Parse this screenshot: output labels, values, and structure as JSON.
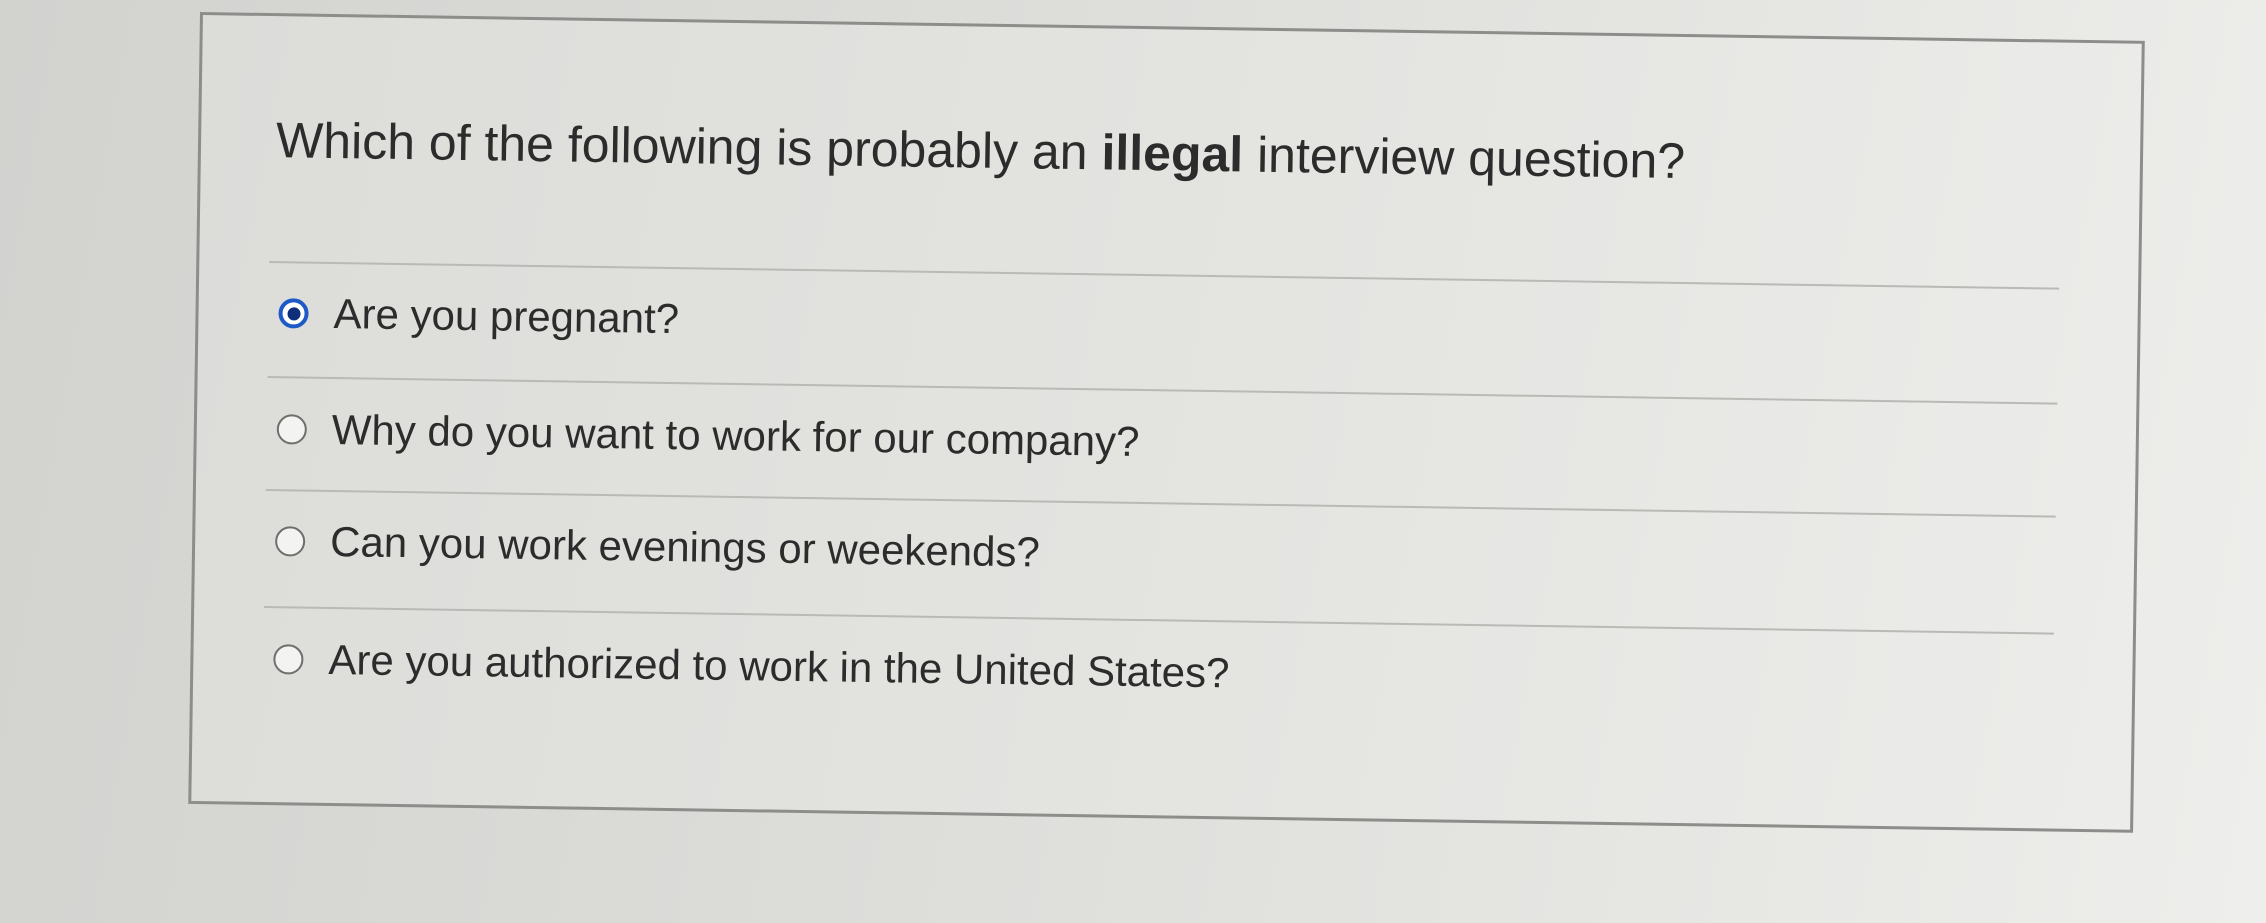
{
  "question": {
    "prefix": "Which of the following is probably an ",
    "emphasis": "illegal",
    "suffix": " interview question?"
  },
  "options": [
    {
      "label": "Are you pregnant?",
      "selected": true
    },
    {
      "label": "Why do you want to work for our company?",
      "selected": false
    },
    {
      "label": "Can you work evenings or weekends?",
      "selected": false
    },
    {
      "label": "Are you authorized to work in the United States?",
      "selected": false
    }
  ],
  "colors": {
    "radio_selected": "#1d5ac8",
    "text": "#2c2c2c"
  }
}
